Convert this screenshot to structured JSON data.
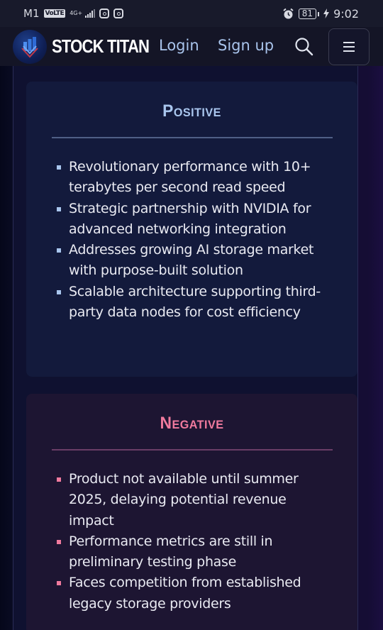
{
  "status_bar": {
    "carrier": "M1",
    "volte": "VoLTE",
    "network": "4G+",
    "battery": "81",
    "time": "9:02"
  },
  "nav": {
    "brand": "STOCK TITAN",
    "login": "Login",
    "signup": "Sign up",
    "icons": [
      "search-icon",
      "menu-icon"
    ]
  },
  "positive": {
    "title": "Positive",
    "accent": "#a9c6ee",
    "items": [
      "Revolutionary performance with 10+ terabytes per second read speed",
      "Strategic partnership with NVIDIA for advanced networking integration",
      "Addresses growing AI storage market with purpose-built solution",
      "Scalable architecture supporting third-party data nodes for cost efficiency"
    ]
  },
  "negative": {
    "title": "Negative",
    "accent": "#f07a9e",
    "items": [
      "Product not available until summer 2025, delaying potential revenue impact",
      "Performance metrics are still in preliminary testing phase",
      "Faces competition from established legacy storage providers"
    ]
  }
}
